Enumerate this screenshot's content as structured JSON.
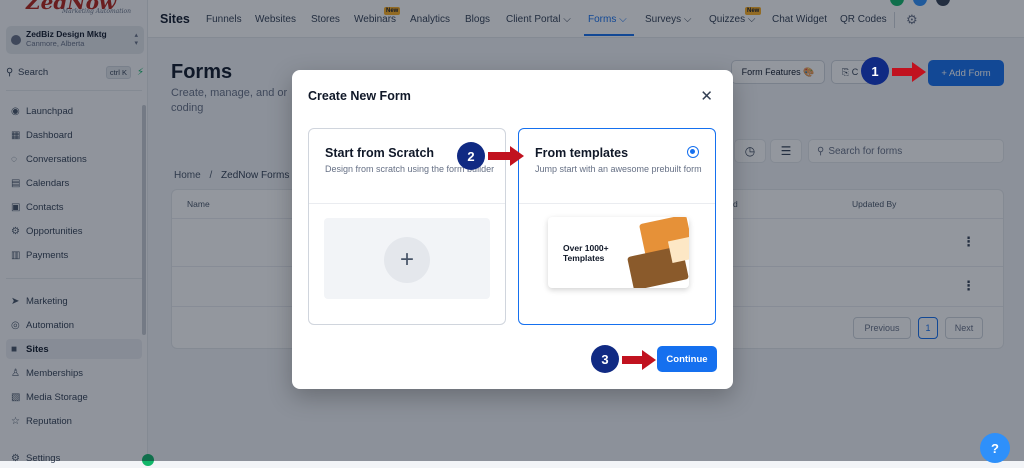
{
  "sidebar": {
    "logo_text": "ZedNow",
    "logo_sub": "Marketing Automation",
    "account_name": "ZedBiz Design Mktg",
    "account_location": "Canmore, Alberta",
    "search_label": "Search",
    "search_shortcut": "ctrl K",
    "items": [
      {
        "label": "Launchpad",
        "icon": "◉"
      },
      {
        "label": "Dashboard",
        "icon": "▦"
      },
      {
        "label": "Conversations",
        "icon": "◌"
      },
      {
        "label": "Calendars",
        "icon": "▤"
      },
      {
        "label": "Contacts",
        "icon": "▣"
      },
      {
        "label": "Opportunities",
        "icon": "⚙"
      },
      {
        "label": "Payments",
        "icon": "▥"
      },
      {
        "label": "Marketing",
        "icon": "➤"
      },
      {
        "label": "Automation",
        "icon": "◎"
      },
      {
        "label": "Sites",
        "icon": "■"
      },
      {
        "label": "Memberships",
        "icon": "♙"
      },
      {
        "label": "Media Storage",
        "icon": "▧"
      },
      {
        "label": "Reputation",
        "icon": "☆"
      },
      {
        "label": "Settings",
        "icon": "⚙"
      }
    ]
  },
  "topnav": {
    "title": "Sites",
    "tabs": [
      {
        "label": "Funnels"
      },
      {
        "label": "Websites"
      },
      {
        "label": "Stores"
      },
      {
        "label": "Webinars",
        "badge": "New"
      },
      {
        "label": "Analytics"
      },
      {
        "label": "Blogs"
      },
      {
        "label": "Client Portal ⌵"
      },
      {
        "label": "Forms ⌵"
      },
      {
        "label": "Surveys ⌵"
      },
      {
        "label": "Quizzes ⌵",
        "badge": "New"
      },
      {
        "label": "Chat Widget"
      },
      {
        "label": "QR Codes"
      }
    ]
  },
  "page": {
    "title": "Forms",
    "subtitle": "Create, manage, and or coding",
    "btn_features": "Form Features 🎨",
    "btn_folder": "⎘ C",
    "btn_add": "+ Add Form",
    "search_placeholder": "Search for forms",
    "breadcrumb_home": "Home",
    "breadcrumb_sep": "/",
    "breadcrumb_current": "ZedNow Forms",
    "col_name": "Name",
    "col_d": "d",
    "col_updated_by": "Updated By",
    "pagination_prev": "Previous",
    "pagination_page": "1",
    "pagination_next": "Next"
  },
  "modal": {
    "title": "Create New Form",
    "close": "✕",
    "options": [
      {
        "title": "Start from Scratch",
        "desc": "Design from scratch using the form builder"
      },
      {
        "title": "From templates",
        "desc": "Jump start with an awesome prebuilt form"
      }
    ],
    "template_preview_text": "Over 1000+ Templates",
    "continue": "Continue"
  },
  "markers": [
    "1",
    "2",
    "3"
  ],
  "colors": {
    "accent": "#1570ef",
    "marker": "#102a83",
    "arrow": "#c1121f"
  }
}
